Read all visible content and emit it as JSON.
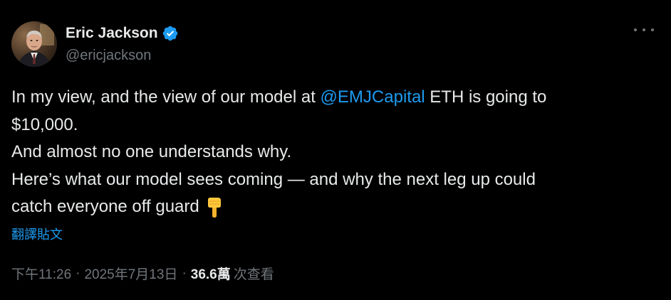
{
  "author": {
    "display_name": "Eric Jackson",
    "handle": "@ericjackson",
    "verified": true,
    "avatar_icon": "profile-photo"
  },
  "tweet": {
    "line1_before": "In my view, and the view of our model at ",
    "mention": "@EMJCapital",
    "line1_after": " ETH is going to",
    "line2": "$10,000.",
    "line3": "And almost no one understands why.",
    "line4": "Here’s what our model sees coming — and why the next leg up could",
    "line5": "catch everyone off guard",
    "emoji": "point-down-emoji",
    "translate_label": "翻譯貼文"
  },
  "meta": {
    "time": "下午11:26",
    "separator": "·",
    "date": "2025年7月13日",
    "views_count": "36.6萬",
    "views_label": "次查看"
  },
  "colors": {
    "background": "#000000",
    "text": "#e7e9ea",
    "secondary": "#71767b",
    "accent": "#1d9bf0"
  }
}
